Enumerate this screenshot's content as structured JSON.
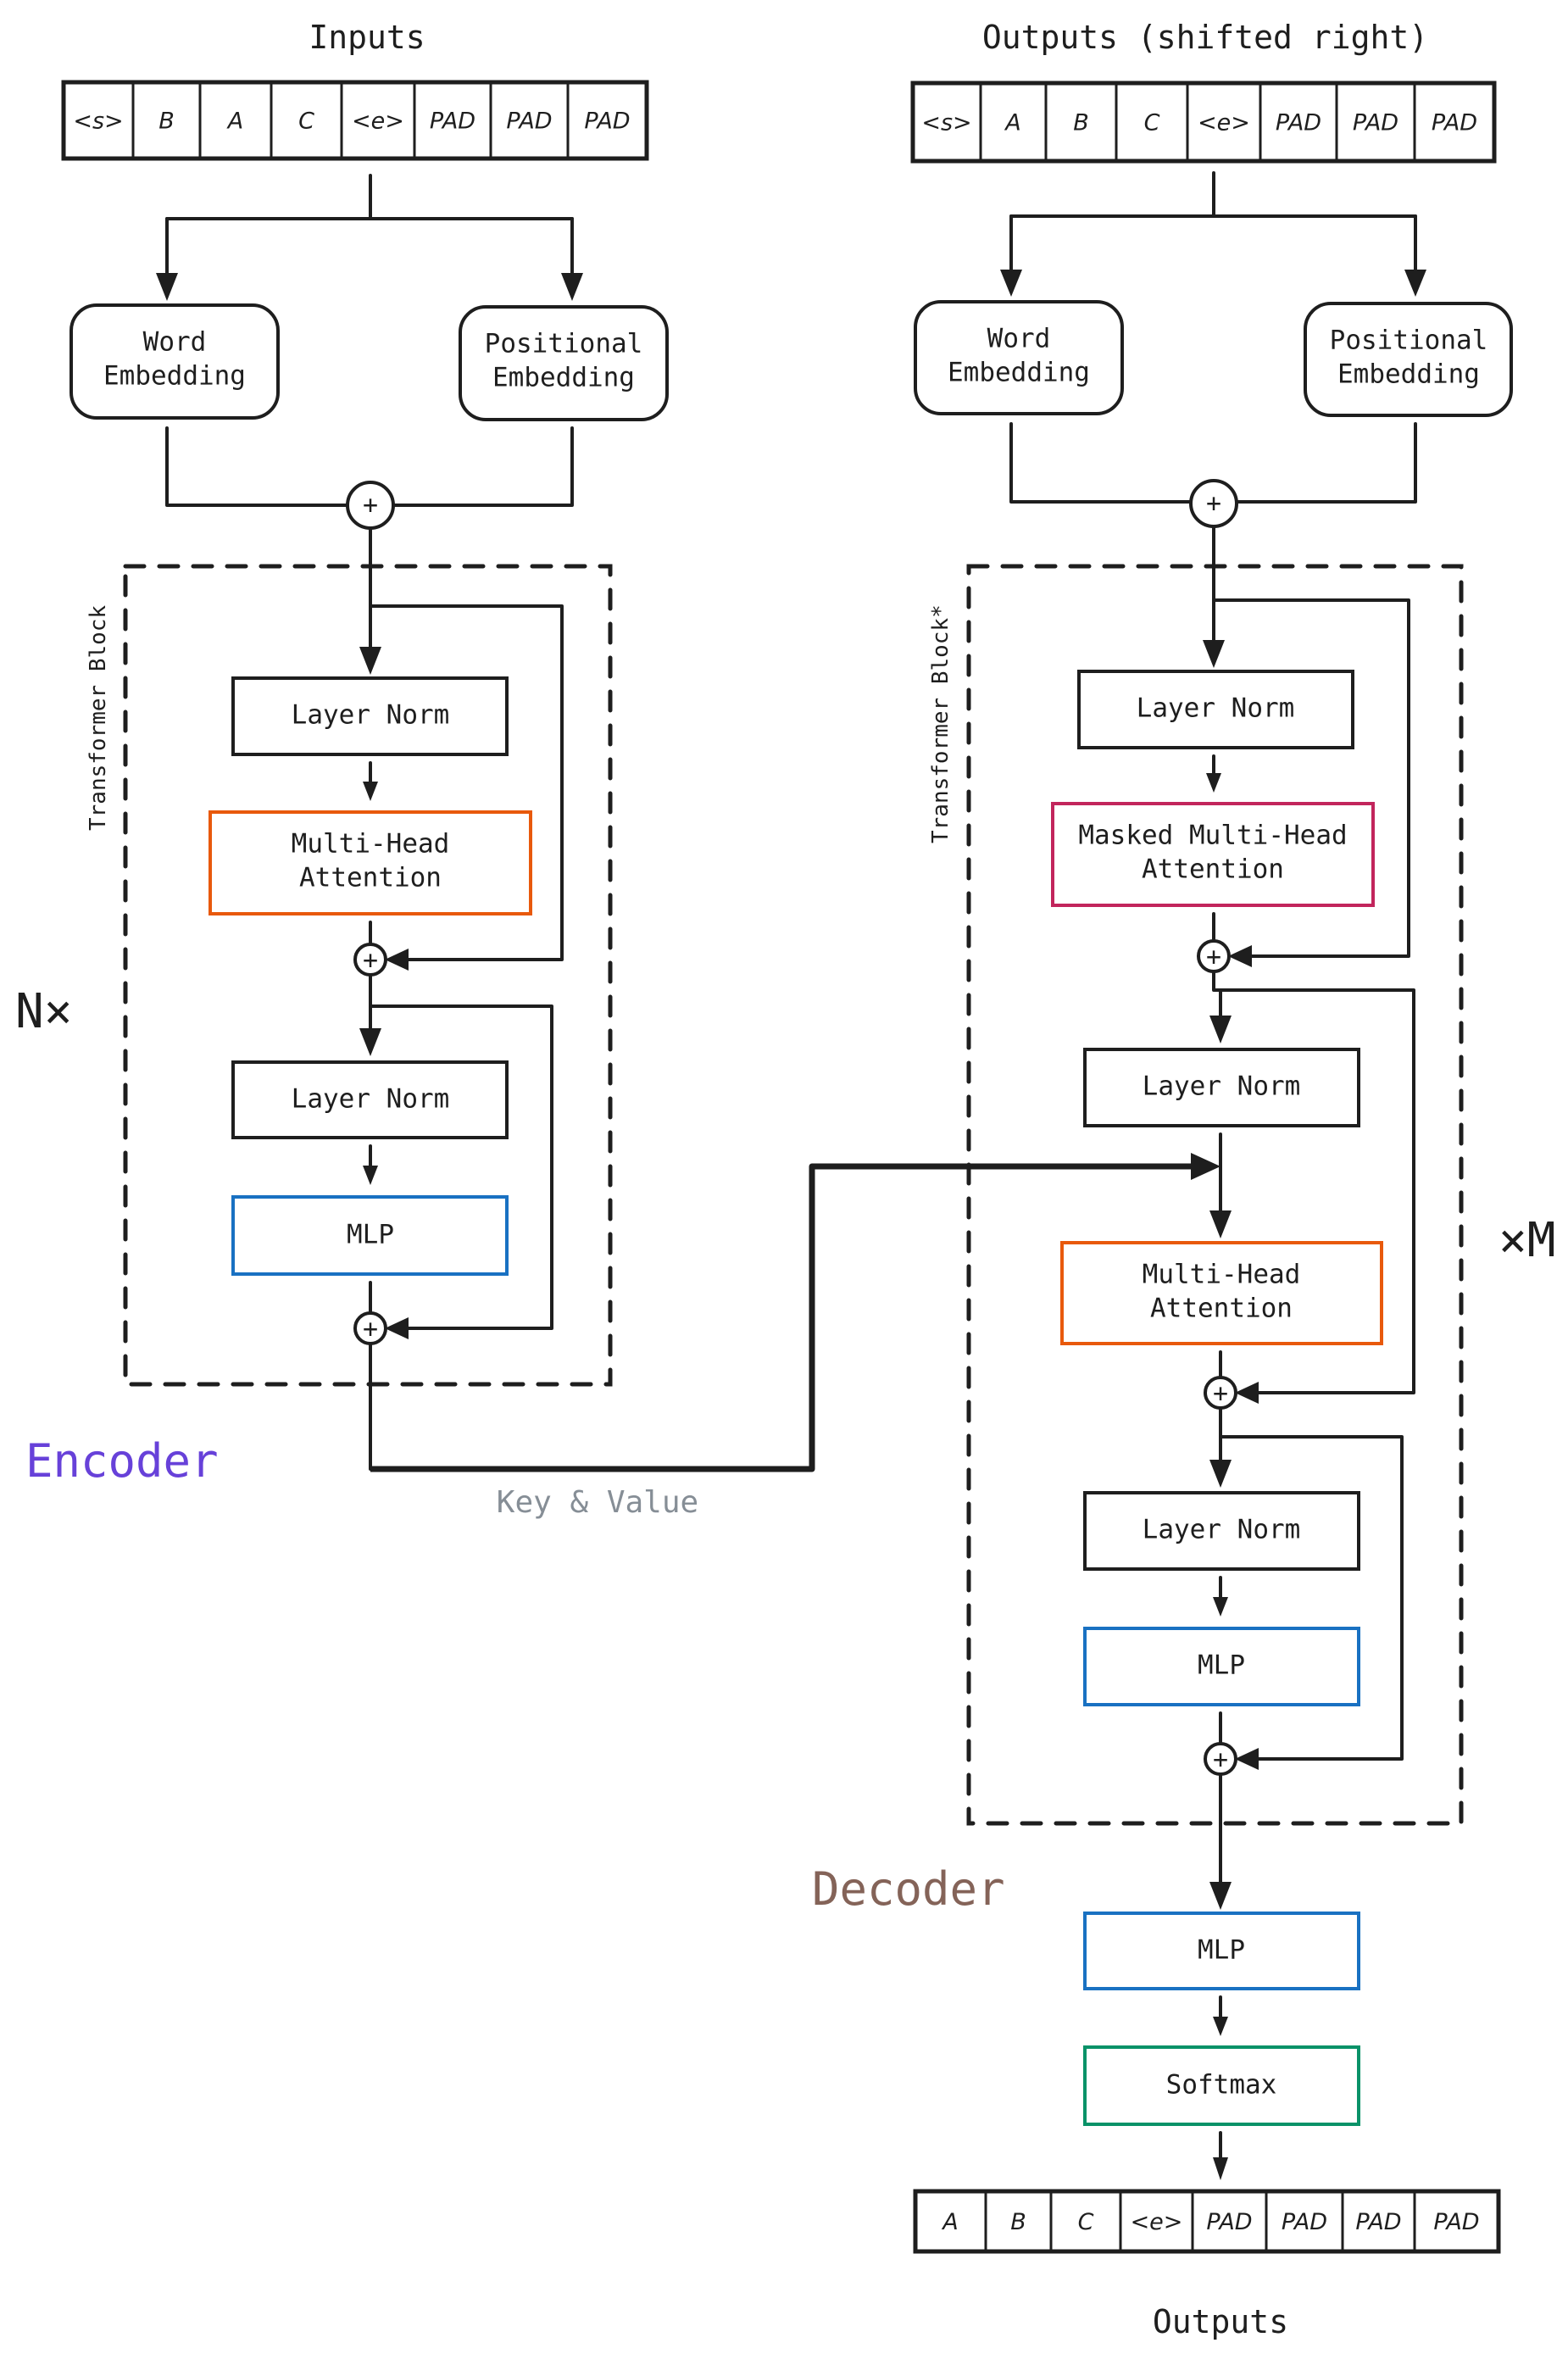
{
  "encoder": {
    "title": "Encoder",
    "title_color": "#6741d9",
    "repeat_label": "N×",
    "block_label": "Transformer Block",
    "inputs_title": "Inputs",
    "input_tokens": [
      "<s>",
      "B",
      "A",
      "C",
      "<e>",
      "PAD",
      "PAD",
      "PAD"
    ],
    "word_embedding": [
      "Word",
      "Embedding"
    ],
    "positional_embedding": [
      "Positional",
      "Embedding"
    ],
    "layer_norm_1": "Layer Norm",
    "attention": [
      "Multi-Head",
      "Attention"
    ],
    "layer_norm_2": "Layer Norm",
    "mlp": "MLP"
  },
  "cross": {
    "label": "Key & Value",
    "label_color": "#868e96"
  },
  "decoder": {
    "title": "Decoder",
    "title_color": "#846358",
    "repeat_label": "×M",
    "block_label": "Transformer Block*",
    "inputs_title": "Outputs (shifted right)",
    "input_tokens": [
      "<s>",
      "A",
      "B",
      "C",
      "<e>",
      "PAD",
      "PAD",
      "PAD"
    ],
    "word_embedding": [
      "Word",
      "Embedding"
    ],
    "positional_embedding": [
      "Positional",
      "Embedding"
    ],
    "layer_norm_1": "Layer Norm",
    "masked_attention": [
      "Masked Multi-Head",
      "Attention"
    ],
    "layer_norm_2": "Layer Norm",
    "cross_attention": [
      "Multi-Head",
      "Attention"
    ],
    "layer_norm_3": "Layer Norm",
    "mlp": "MLP",
    "final_mlp": "MLP",
    "softmax": "Softmax",
    "output_tokens": [
      "A",
      "B",
      "C",
      "<e>",
      "PAD",
      "PAD",
      "PAD",
      "PAD"
    ],
    "outputs_title": "Outputs"
  },
  "colors": {
    "attention": "#e8590c",
    "masked_attention": "#c2255c",
    "mlp": "#1971c2",
    "softmax": "#099268",
    "line": "#1e1e1e"
  },
  "plus_symbol": "+"
}
